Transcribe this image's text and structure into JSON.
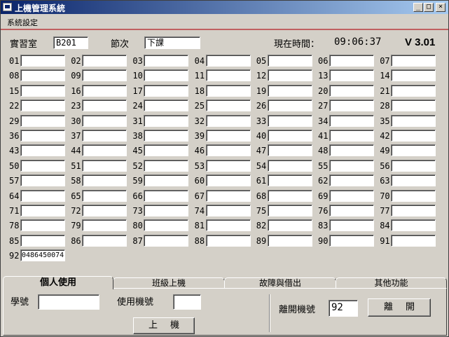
{
  "window": {
    "title": "上機管理系統",
    "controls": [
      "_",
      "□",
      "×"
    ]
  },
  "menu": {
    "items": [
      "系統設定"
    ]
  },
  "header": {
    "lab_label": "實習室",
    "lab_value": "B201",
    "period_label": "節次",
    "period_value": "下課",
    "time_label": "現在時間：",
    "time_value": "09:06:37",
    "version": "V 3.01"
  },
  "machines": [
    {
      "n": "01",
      "v": ""
    },
    {
      "n": "02",
      "v": ""
    },
    {
      "n": "03",
      "v": ""
    },
    {
      "n": "04",
      "v": ""
    },
    {
      "n": "05",
      "v": ""
    },
    {
      "n": "06",
      "v": ""
    },
    {
      "n": "07",
      "v": ""
    },
    {
      "n": "08",
      "v": ""
    },
    {
      "n": "09",
      "v": ""
    },
    {
      "n": "10",
      "v": ""
    },
    {
      "n": "11",
      "v": ""
    },
    {
      "n": "12",
      "v": ""
    },
    {
      "n": "13",
      "v": ""
    },
    {
      "n": "14",
      "v": ""
    },
    {
      "n": "15",
      "v": ""
    },
    {
      "n": "16",
      "v": ""
    },
    {
      "n": "17",
      "v": ""
    },
    {
      "n": "18",
      "v": ""
    },
    {
      "n": "19",
      "v": ""
    },
    {
      "n": "20",
      "v": ""
    },
    {
      "n": "21",
      "v": ""
    },
    {
      "n": "22",
      "v": ""
    },
    {
      "n": "23",
      "v": ""
    },
    {
      "n": "24",
      "v": ""
    },
    {
      "n": "25",
      "v": ""
    },
    {
      "n": "26",
      "v": ""
    },
    {
      "n": "27",
      "v": ""
    },
    {
      "n": "28",
      "v": ""
    },
    {
      "n": "29",
      "v": ""
    },
    {
      "n": "30",
      "v": ""
    },
    {
      "n": "31",
      "v": ""
    },
    {
      "n": "32",
      "v": ""
    },
    {
      "n": "33",
      "v": ""
    },
    {
      "n": "34",
      "v": ""
    },
    {
      "n": "35",
      "v": ""
    },
    {
      "n": "36",
      "v": ""
    },
    {
      "n": "37",
      "v": ""
    },
    {
      "n": "38",
      "v": ""
    },
    {
      "n": "39",
      "v": ""
    },
    {
      "n": "40",
      "v": ""
    },
    {
      "n": "41",
      "v": ""
    },
    {
      "n": "42",
      "v": ""
    },
    {
      "n": "43",
      "v": ""
    },
    {
      "n": "44",
      "v": ""
    },
    {
      "n": "45",
      "v": ""
    },
    {
      "n": "46",
      "v": ""
    },
    {
      "n": "47",
      "v": ""
    },
    {
      "n": "48",
      "v": ""
    },
    {
      "n": "49",
      "v": ""
    },
    {
      "n": "50",
      "v": ""
    },
    {
      "n": "51",
      "v": ""
    },
    {
      "n": "52",
      "v": ""
    },
    {
      "n": "53",
      "v": ""
    },
    {
      "n": "54",
      "v": ""
    },
    {
      "n": "55",
      "v": ""
    },
    {
      "n": "56",
      "v": ""
    },
    {
      "n": "57",
      "v": ""
    },
    {
      "n": "58",
      "v": ""
    },
    {
      "n": "59",
      "v": ""
    },
    {
      "n": "60",
      "v": ""
    },
    {
      "n": "61",
      "v": ""
    },
    {
      "n": "62",
      "v": ""
    },
    {
      "n": "63",
      "v": ""
    },
    {
      "n": "64",
      "v": ""
    },
    {
      "n": "65",
      "v": ""
    },
    {
      "n": "66",
      "v": ""
    },
    {
      "n": "67",
      "v": ""
    },
    {
      "n": "68",
      "v": ""
    },
    {
      "n": "69",
      "v": ""
    },
    {
      "n": "70",
      "v": ""
    },
    {
      "n": "71",
      "v": ""
    },
    {
      "n": "72",
      "v": ""
    },
    {
      "n": "73",
      "v": ""
    },
    {
      "n": "74",
      "v": ""
    },
    {
      "n": "75",
      "v": ""
    },
    {
      "n": "76",
      "v": ""
    },
    {
      "n": "77",
      "v": ""
    },
    {
      "n": "78",
      "v": ""
    },
    {
      "n": "79",
      "v": ""
    },
    {
      "n": "80",
      "v": ""
    },
    {
      "n": "81",
      "v": ""
    },
    {
      "n": "82",
      "v": ""
    },
    {
      "n": "83",
      "v": ""
    },
    {
      "n": "84",
      "v": ""
    },
    {
      "n": "85",
      "v": ""
    },
    {
      "n": "86",
      "v": ""
    },
    {
      "n": "87",
      "v": ""
    },
    {
      "n": "88",
      "v": ""
    },
    {
      "n": "89",
      "v": ""
    },
    {
      "n": "90",
      "v": ""
    },
    {
      "n": "91",
      "v": ""
    },
    {
      "n": "92",
      "v": "0486450074"
    }
  ],
  "tabs": [
    "個人使用",
    "班級上機",
    "故障與借出",
    "其他功能"
  ],
  "personal": {
    "student_id_label": "學號",
    "student_id_value": "",
    "machine_label": "使用機號",
    "machine_value": "",
    "login_button": "上機",
    "logout_label": "離開機號",
    "logout_value": "92",
    "logout_button": "離開"
  }
}
